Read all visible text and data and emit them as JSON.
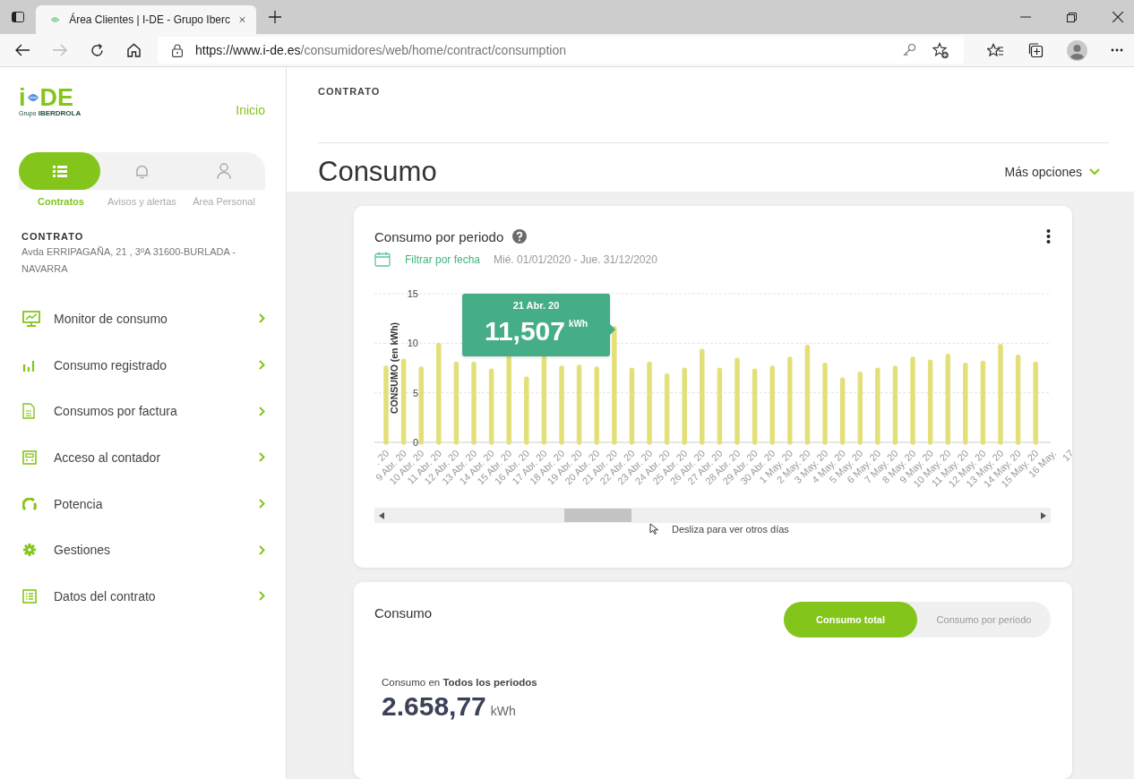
{
  "browser": {
    "tab_title": "Área Clientes | I-DE - Grupo Iberc",
    "url_host": "https://www.i-de.es",
    "url_path": "/consumidores/web/home/contract/consumption"
  },
  "sidebar": {
    "logo": {
      "mark_left": "i",
      "mark_right": "DE",
      "caption_small": "Grupo",
      "caption": "IBERDROLA"
    },
    "home_link": "Inicio",
    "tabs": [
      {
        "label": "Contratos",
        "selected": true
      },
      {
        "label": "Avisos y alertas",
        "selected": false
      },
      {
        "label": "Área Personal",
        "selected": false
      }
    ],
    "contract": {
      "heading": "CONTRATO",
      "address": "Avda ERRIPAGAÑA, 21 , 3ºA 31600-BURLADA - NAVARRA"
    },
    "menu": [
      {
        "label": "Monitor de consumo"
      },
      {
        "label": "Consumo registrado"
      },
      {
        "label": "Consumos por factura"
      },
      {
        "label": "Acceso al contador"
      },
      {
        "label": "Potencia"
      },
      {
        "label": "Gestiones"
      },
      {
        "label": "Datos del contrato"
      }
    ]
  },
  "main": {
    "section_label": "CONTRATO",
    "title": "Consumo",
    "more_options": "Más opciones",
    "period_card": {
      "title": "Consumo por periodo",
      "filter_label": "Filtrar por fecha",
      "date_range": "Mié. 01/01/2020 - Jue. 31/12/2020",
      "tooltip": {
        "date": "21 Abr. 20",
        "value": "11,507",
        "unit": "kWh"
      },
      "scroll_hint": "Desliza para ver otros días",
      "chart_data": {
        "type": "bar",
        "ylabel": "CONSUMO (en kWh)",
        "ylim": [
          0,
          15
        ],
        "yticks": [
          0,
          5,
          10,
          15
        ],
        "categories": [
          ". 20",
          "9 Abr. 20",
          "10 Abr. 20",
          "11 Abr. 20",
          "12 Abr. 20",
          "13 Abr. 20",
          "14 Abr. 20",
          "15 Abr. 20",
          "16 Abr. 20",
          "17 Abr. 20",
          "18 Abr. 20",
          "19 Abr. 20",
          "20 Abr. 20",
          "21 Abr. 20",
          "22 Abr. 20",
          "23 Abr. 20",
          "24 Abr. 20",
          "25 Abr. 20",
          "26 Abr. 20",
          "27 Abr. 20",
          "28 Abr. 20",
          "29 Abr. 20",
          "30 Abr. 20",
          "1 May. 20",
          "2 May. 20",
          "3 May. 20",
          "4 May. 20",
          "5 May. 20",
          "6 May. 20",
          "7 May. 20",
          "8 May. 20",
          "9 May. 20",
          "10 May. 20",
          "11 May. 20",
          "12 May. 20",
          "13 May. 20",
          "14 May. 20",
          "15 May. 20",
          "16 May.",
          "17"
        ],
        "series": [
          {
            "color": "#e3e07a",
            "values": [
              7.5,
              8.2,
              7.4,
              9.8,
              7.9,
              7.9,
              7.2,
              8.5,
              6.4,
              8.5,
              7.5,
              7.6,
              7.4,
              11.5,
              7.3,
              7.9,
              6.7,
              7.3,
              9.2,
              7.3,
              8.3,
              7.2,
              7.5,
              8.4,
              9.6,
              7.8,
              6.3,
              6.9,
              7.3,
              7.5,
              8.4,
              8.1,
              8.7,
              7.8,
              8.0,
              9.7,
              8.6,
              7.9,
              null,
              null
            ]
          }
        ]
      }
    },
    "total_card": {
      "title": "Consumo",
      "toggle": [
        {
          "label": "Consumo total",
          "selected": true
        },
        {
          "label": "Consumo por periodo",
          "selected": false
        }
      ],
      "summary_label": "Consumo en **Todos los periodos**",
      "total": "2.658,77",
      "unit": "kWh"
    }
  }
}
